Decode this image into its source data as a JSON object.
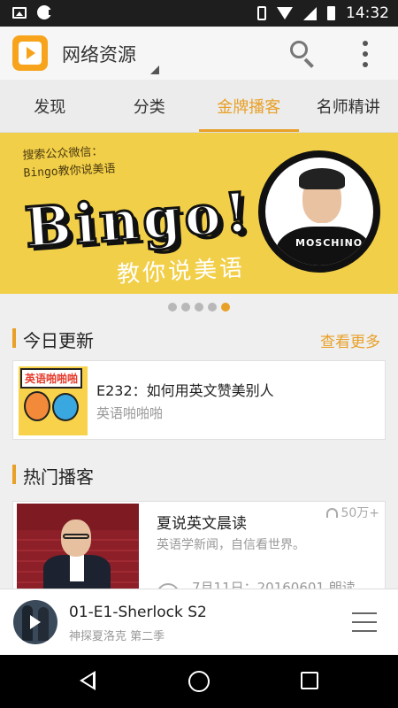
{
  "status_bar": {
    "time": "14:32"
  },
  "app_bar": {
    "title": "网络资源"
  },
  "tabs": [
    {
      "label": "发现",
      "active": false
    },
    {
      "label": "分类",
      "active": false
    },
    {
      "label": "金牌播客",
      "active": true
    },
    {
      "label": "名师精讲",
      "active": false
    }
  ],
  "banner": {
    "line1": "搜索公众微信：",
    "line2": "Bingo教你说美语",
    "headline": "Bingo!",
    "subtitle": "教你说美语",
    "shirt_text": "MOSCHINO",
    "page_count": 5,
    "active_page": 5
  },
  "today_updates": {
    "title": "今日更新",
    "more": "查看更多",
    "items": [
      {
        "thumb_tag": "英语啪啪啪",
        "title": "E232：如何用英文赞美别人",
        "subtitle": "英语啪啪啪"
      }
    ]
  },
  "hot_podcasts": {
    "title": "热门播客",
    "items": [
      {
        "title": "夏说英文晨读",
        "subtitle": "英语学新闻，自信看世界。",
        "listen_count": "50万+",
        "latest": "7月11日：20160601 朗读"
      }
    ]
  },
  "player": {
    "track": "01-E1-Sherlock S2",
    "album": "神探夏洛克 第二季"
  },
  "colors": {
    "accent": "#e8a027",
    "banner_bg": "#f2cf48"
  }
}
